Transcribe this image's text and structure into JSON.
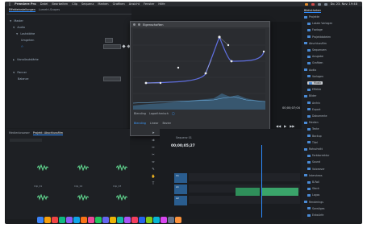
{
  "menubar": {
    "items": [
      "Premiere Pro",
      "Datei",
      "Bearbeiten",
      "Clip",
      "Sequenz",
      "Marken",
      "Grafiken",
      "Ansicht",
      "Fenster",
      "Hilfe"
    ],
    "status": "Do. 23. Nov. 19:48"
  },
  "effects_panel": {
    "tabs": [
      "Effekteinstellungen",
      "Lumetri-Scopes"
    ],
    "rows": [
      "Master",
      "Audio",
      "Lautstärke",
      "Umgehen",
      "Kanallautstärke",
      "Panner",
      "Balance"
    ]
  },
  "graph_window": {
    "title": "Eigenschaften",
    "bottom_row1": [
      "Blending",
      "Logarithmisch"
    ],
    "bottom_row2": [
      "Blending",
      "Linear",
      "Bezier"
    ],
    "colors": {
      "curve": "#5f6fe0",
      "point": "#e9ecef",
      "fill": "#3e6a8a"
    }
  },
  "program_monitor": {
    "timecode": "00;00;07;04"
  },
  "lower_left": {
    "tabs": [
      "Medienbrowser",
      "Projekt: Abschlussfilm"
    ],
    "clip_labels": [
      "Clip_01",
      "Clip_02",
      "Clip_03",
      "Clip_04",
      "Clip_05",
      "Clip_06"
    ]
  },
  "timeline": {
    "tabs": [
      "Sequenz 01"
    ],
    "timecode": "00;00;05;27",
    "track_labels": [
      "V1",
      "A1",
      "A2",
      "A3"
    ]
  },
  "browser_panel": {
    "title": "Bibliotheken",
    "items": [
      "Projekte",
      "Lokale Vorlagen",
      "Footage",
      "Projektdateien",
      "Abschlussfilm",
      "Sequenzen",
      "Ausgabe",
      "Grafiken",
      "Audio",
      "Vorlagen",
      "Musik",
      "Effekte",
      "Bilder",
      "Archiv",
      "Export",
      "Dokumente",
      "Medien",
      "Texte",
      "Backup",
      "Titel",
      "Rohschnitt",
      "Farbkorrektur",
      "Sound",
      "Voiceover",
      "Interviews",
      "B-Roll",
      "Stock",
      "Logos",
      "Renderings",
      "Sonstiges",
      "Entwürfe"
    ],
    "selected_index": 10
  }
}
